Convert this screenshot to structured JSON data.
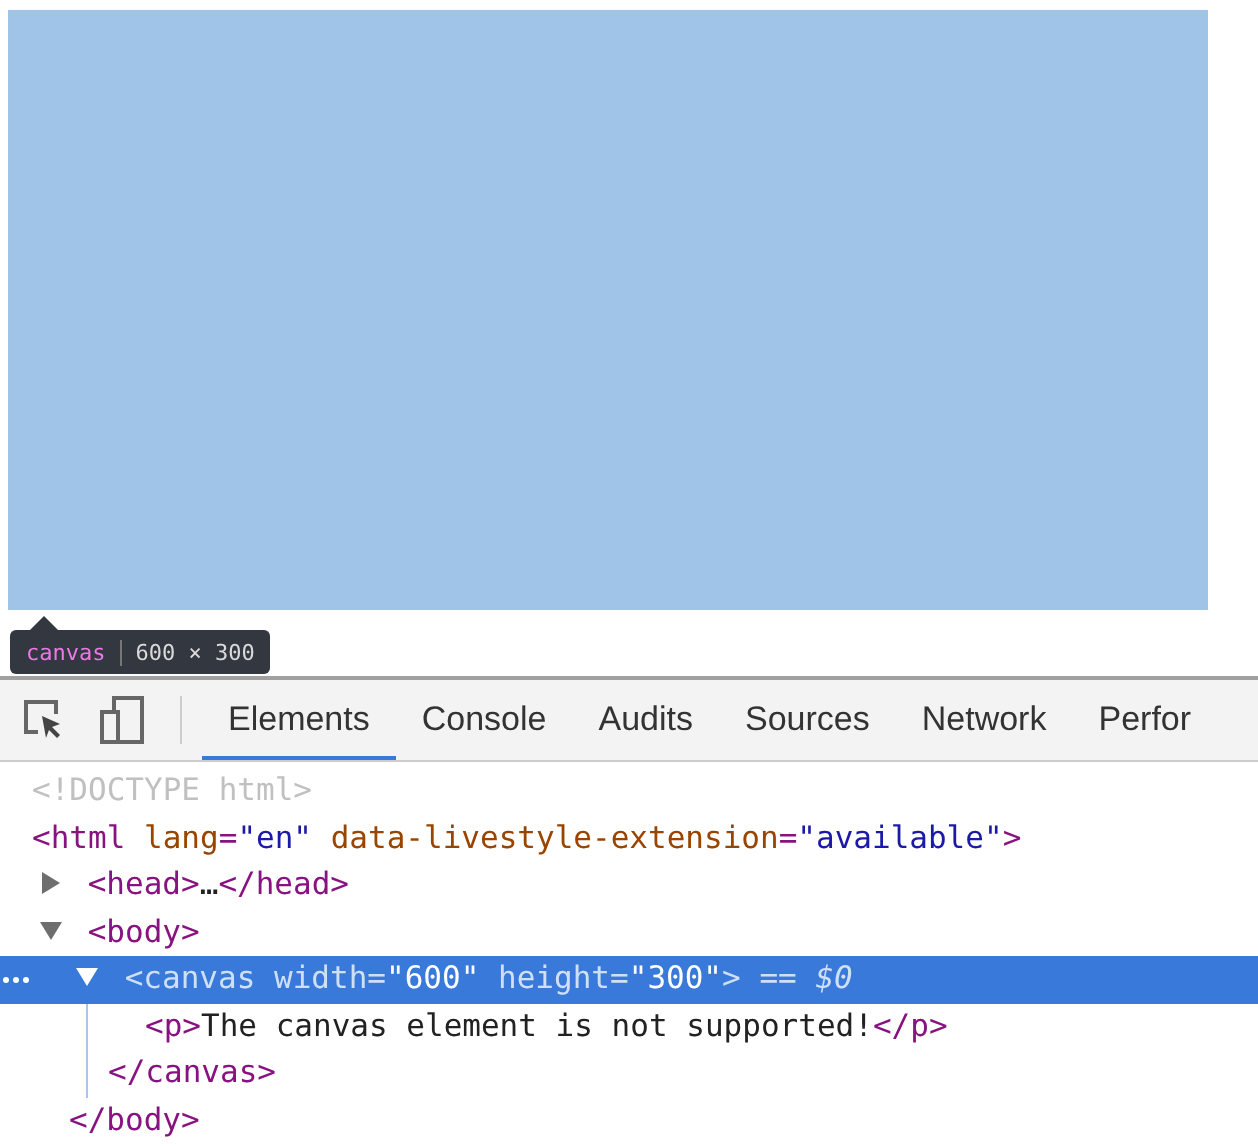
{
  "tooltip": {
    "tag": "canvas",
    "size": "600 × 300"
  },
  "tabs": [
    {
      "label": "Elements",
      "selected": true
    },
    {
      "label": "Console",
      "selected": false
    },
    {
      "label": "Audits",
      "selected": false
    },
    {
      "label": "Sources",
      "selected": false
    },
    {
      "label": "Network",
      "selected": false
    },
    {
      "label": "Perfor",
      "selected": false
    }
  ],
  "tree": [
    {
      "tokens": [
        {
          "kind": "doctype",
          "text": "<!DOCTYPE html>"
        }
      ],
      "selected": false
    },
    {
      "tokens": [
        {
          "kind": "tag",
          "text": "<html"
        },
        {
          "kind": "attr",
          "text": " lang"
        },
        {
          "kind": "tag",
          "text": "="
        },
        {
          "kind": "value",
          "text": "\"en\""
        },
        {
          "kind": "attr",
          "text": " data-livestyle-extension"
        },
        {
          "kind": "tag",
          "text": "="
        },
        {
          "kind": "value",
          "text": "\"available\""
        },
        {
          "kind": "tag",
          "text": ">"
        }
      ],
      "selected": false,
      "children": [
        {
          "tokens": [
            {
              "kind": "tag",
              "text": "<head>"
            },
            {
              "kind": "text",
              "text": "…"
            },
            {
              "kind": "tag",
              "text": "</head>"
            }
          ],
          "expanded": false,
          "selected": false
        },
        {
          "tokens": [
            {
              "kind": "tag",
              "text": "<body>"
            }
          ],
          "expanded": true,
          "selected": false,
          "children": [
            {
              "tokens": [
                {
                  "kind": "tag",
                  "text": "<canvas"
                },
                {
                  "kind": "attr",
                  "text": " width"
                },
                {
                  "kind": "tag",
                  "text": "="
                },
                {
                  "kind": "value",
                  "text": "\"600\""
                },
                {
                  "kind": "attr",
                  "text": " height"
                },
                {
                  "kind": "tag",
                  "text": "="
                },
                {
                  "kind": "value",
                  "text": "\"300\""
                },
                {
                  "kind": "tag",
                  "text": ">"
                },
                {
                  "kind": "marker",
                  "text": " == $0"
                }
              ],
              "expanded": true,
              "selected": true,
              "children": [
                {
                  "tokens": [
                    {
                      "kind": "tag",
                      "text": "<p>"
                    },
                    {
                      "kind": "text",
                      "text": "The canvas element is not supported!"
                    },
                    {
                      "kind": "tag",
                      "text": "</p>"
                    }
                  ],
                  "selected": false
                }
              ],
              "closing": [
                {
                  "kind": "tag",
                  "text": "</canvas>"
                }
              ]
            }
          ],
          "closing": [
            {
              "kind": "tag",
              "text": "</body>"
            }
          ]
        }
      ]
    }
  ]
}
